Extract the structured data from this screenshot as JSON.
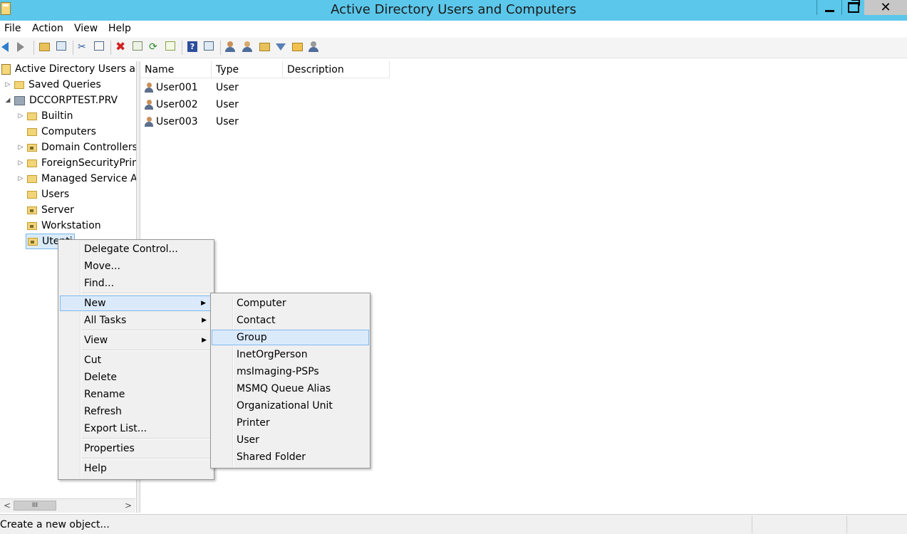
{
  "window": {
    "title": "Active Directory Users and Computers"
  },
  "menubar": {
    "items": [
      "File",
      "Action",
      "View",
      "Help"
    ]
  },
  "toolbar": {
    "icons": [
      "back-arrow-icon",
      "forward-arrow-icon",
      "up-folder-icon",
      "show-hide-console-tree-icon",
      "cut-icon",
      "copy-icon",
      "delete-icon",
      "properties-icon",
      "refresh-icon",
      "export-list-icon",
      "help-icon",
      "console-view-icon",
      "new-user-icon",
      "new-group-icon",
      "new-ou-icon",
      "filter-icon",
      "find-icon",
      "add-to-group-icon"
    ]
  },
  "tree": {
    "root": "Active Directory Users and Computers",
    "saved_queries": "Saved Queries",
    "domain": "DCCORPTEST.PRV",
    "children": [
      "Builtin",
      "Computers",
      "Domain Controllers",
      "ForeignSecurityPrincipals",
      "Managed Service Accounts",
      "Users",
      "Server",
      "Workstation",
      "Utenti"
    ]
  },
  "list": {
    "columns": [
      "Name",
      "Type",
      "Description"
    ],
    "rows": [
      {
        "name": "User001",
        "type": "User",
        "description": ""
      },
      {
        "name": "User002",
        "type": "User",
        "description": ""
      },
      {
        "name": "User003",
        "type": "User",
        "description": ""
      }
    ]
  },
  "context_menu": {
    "items": {
      "delegate": "Delegate Control...",
      "move": "Move...",
      "find": "Find...",
      "new": "New",
      "all_tasks": "All Tasks",
      "view": "View",
      "cut": "Cut",
      "delete": "Delete",
      "rename": "Rename",
      "refresh": "Refresh",
      "export": "Export List...",
      "properties": "Properties",
      "help": "Help"
    },
    "highlighted": "New"
  },
  "submenu_new": {
    "items": [
      "Computer",
      "Contact",
      "Group",
      "InetOrgPerson",
      "msImaging-PSPs",
      "MSMQ Queue Alias",
      "Organizational Unit",
      "Printer",
      "User",
      "Shared Folder"
    ],
    "highlighted": "Group"
  },
  "statusbar": {
    "text": "Create a new object..."
  },
  "scrollbar": {
    "left": "<",
    "right": ">",
    "thumb": "III"
  },
  "colors": {
    "titlebar": "#5bc7ea",
    "highlight_bg": "#dbeafb",
    "highlight_border": "#80b9ee"
  }
}
